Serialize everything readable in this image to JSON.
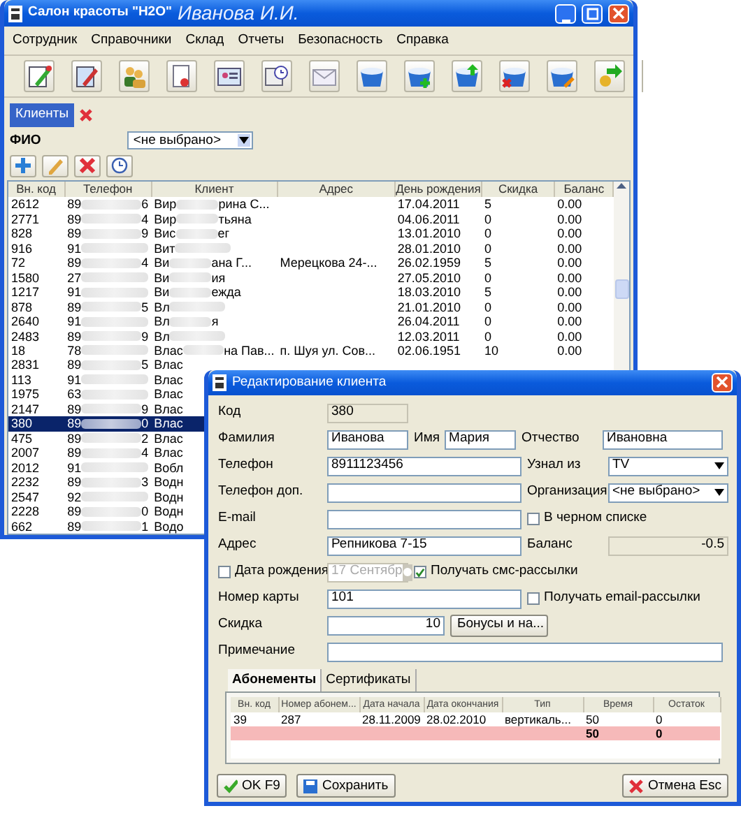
{
  "window": {
    "title": "Салон красоты \"H2O\"",
    "user": "Иванова И.И."
  },
  "menu": [
    "Сотрудник",
    "Справочники",
    "Склад",
    "Отчеты",
    "Безопасность",
    "Справка"
  ],
  "doc_tabs": [
    {
      "label": "Клиенты",
      "selected": true
    }
  ],
  "filter": {
    "label": "ФИО",
    "value": "<не выбрано>"
  },
  "clients": {
    "columns": [
      "Вн. код",
      "Телефон",
      "Клиент",
      "Адрес",
      "День рождения",
      "Скидка",
      "Баланс"
    ],
    "rows": [
      {
        "selected": false,
        "code": "2612",
        "phone": [
          "89",
          "6"
        ],
        "client": [
          "Вир",
          "рина С..."
        ],
        "birthday": "17.04.2011",
        "discount": "5",
        "balance": "0.00"
      },
      {
        "selected": false,
        "code": "2771",
        "phone": [
          "89",
          "4"
        ],
        "client": [
          "Вир",
          "тьяна"
        ],
        "birthday": "04.06.2011",
        "discount": "0",
        "balance": "0.00"
      },
      {
        "selected": false,
        "code": "828",
        "phone": [
          "89",
          "9"
        ],
        "client": [
          "Вис",
          "ег"
        ],
        "birthday": "13.01.2010",
        "discount": "0",
        "balance": "0.00"
      },
      {
        "selected": false,
        "code": "916",
        "phone": [
          "91"
        ],
        "client": [
          "Вит"
        ],
        "birthday": "28.01.2010",
        "discount": "0",
        "balance": "0.00"
      },
      {
        "selected": false,
        "code": "72",
        "phone": [
          "89",
          "4"
        ],
        "client": [
          "Ви",
          "ана Г..."
        ],
        "address": "Мерецкова 24-...",
        "birthday": "26.02.1959",
        "discount": "5",
        "balance": "0.00"
      },
      {
        "selected": false,
        "code": "1580",
        "phone": [
          "27"
        ],
        "client": [
          "Ви",
          "ия"
        ],
        "birthday": "27.05.2010",
        "discount": "0",
        "balance": "0.00"
      },
      {
        "selected": false,
        "code": "1217",
        "phone": [
          "91"
        ],
        "client": [
          "Ви",
          "ежда"
        ],
        "birthday": "18.03.2010",
        "discount": "5",
        "balance": "0.00"
      },
      {
        "selected": false,
        "code": "878",
        "phone": [
          "89",
          "5"
        ],
        "client": [
          "Вл"
        ],
        "birthday": "21.01.2010",
        "discount": "0",
        "balance": "0.00"
      },
      {
        "selected": false,
        "code": "2640",
        "phone": [
          "91"
        ],
        "client": [
          "Вл",
          "я"
        ],
        "birthday": "26.04.2011",
        "discount": "0",
        "balance": "0.00"
      },
      {
        "selected": false,
        "code": "2483",
        "phone": [
          "89",
          "9"
        ],
        "client": [
          "Вл"
        ],
        "birthday": "12.03.2011",
        "discount": "0",
        "balance": "0.00"
      },
      {
        "selected": false,
        "code": "18",
        "phone": [
          "78"
        ],
        "client": [
          "Влас",
          "на Пав..."
        ],
        "address": "п. Шуя ул. Сов...",
        "birthday": "02.06.1951",
        "discount": "10",
        "balance": "0.00"
      },
      {
        "selected": false,
        "code": "2831",
        "phone": [
          "89",
          "5"
        ],
        "client": [
          "Влас"
        ]
      },
      {
        "selected": false,
        "code": "113",
        "phone": [
          "91"
        ],
        "client": [
          "Влас"
        ]
      },
      {
        "selected": false,
        "code": "1975",
        "phone": [
          "63"
        ],
        "client": [
          "Влас"
        ]
      },
      {
        "selected": false,
        "code": "2147",
        "phone": [
          "89",
          "9"
        ],
        "client": [
          "Влас"
        ]
      },
      {
        "selected": true,
        "code": "380",
        "phone": [
          "89",
          "0"
        ],
        "client": [
          "Влас"
        ]
      },
      {
        "selected": false,
        "code": "475",
        "phone": [
          "89",
          "2"
        ],
        "client": [
          "Влас"
        ]
      },
      {
        "selected": false,
        "code": "2007",
        "phone": [
          "89",
          "4"
        ],
        "client": [
          "Влас"
        ]
      },
      {
        "selected": false,
        "code": "2012",
        "phone": [
          "91"
        ],
        "client": [
          "Вобл"
        ]
      },
      {
        "selected": false,
        "code": "2232",
        "phone": [
          "89",
          "3"
        ],
        "client": [
          "Водн"
        ]
      },
      {
        "selected": false,
        "code": "2547",
        "phone": [
          "92"
        ],
        "client": [
          "Водн"
        ]
      },
      {
        "selected": false,
        "code": "2228",
        "phone": [
          "89",
          "0"
        ],
        "client": [
          "Водн"
        ]
      },
      {
        "selected": false,
        "code": "662",
        "phone": [
          "89",
          "1"
        ],
        "client": [
          "Водо"
        ]
      }
    ]
  },
  "dialog": {
    "title": "Редактирование клиента",
    "rows": [
      [
        {
          "kind": "label",
          "text": "Код"
        },
        {
          "kind": "readonly",
          "value": "380"
        }
      ],
      [
        {
          "kind": "label",
          "text": "Фамилия"
        },
        {
          "kind": "input",
          "value": "Иванова"
        },
        {
          "kind": "label",
          "text": "Имя"
        },
        {
          "kind": "input",
          "value": "Мария"
        },
        {
          "kind": "label",
          "text": "Отчество"
        },
        {
          "kind": "input",
          "value": "Ивановна"
        }
      ],
      [
        {
          "kind": "label",
          "text": "Телефон"
        },
        {
          "kind": "input",
          "value": "8911123456"
        },
        {
          "kind": "label",
          "text": "Узнал из"
        },
        {
          "kind": "select",
          "value": "TV"
        }
      ],
      [
        {
          "kind": "label",
          "text": "Телефон доп."
        },
        {
          "kind": "input"
        },
        {
          "kind": "label",
          "text": "Организация"
        },
        {
          "kind": "select",
          "value": "<не выбрано>"
        }
      ],
      [
        {
          "kind": "label",
          "text": "E-mail"
        },
        {
          "kind": "input"
        },
        {
          "kind": "check",
          "text": "В черном списке",
          "checked": false
        }
      ],
      [
        {
          "kind": "label",
          "text": "Адрес"
        },
        {
          "kind": "input",
          "value": "Репникова 7-15"
        },
        {
          "kind": "label",
          "text": "Баланс"
        },
        {
          "kind": "readonly_number",
          "value": "-0.5"
        }
      ],
      [
        {
          "kind": "check",
          "text": "Дата рождения",
          "checked": false
        },
        {
          "kind": "date",
          "value": "17 Сентябр",
          "disabled": true
        },
        {
          "kind": "check",
          "text": "Получать смс-рассылки",
          "checked": true
        }
      ],
      [
        {
          "kind": "label",
          "text": "Номер карты"
        },
        {
          "kind": "input",
          "value": "101"
        },
        {
          "kind": "check",
          "text": "Получать email-рассылки",
          "checked": false
        }
      ],
      [
        {
          "kind": "label",
          "text": "Скидка"
        },
        {
          "kind": "number",
          "value": "10"
        },
        {
          "kind": "button",
          "text": "Бонусы и на..."
        }
      ],
      [
        {
          "kind": "label",
          "text": "Примечание"
        },
        {
          "kind": "input"
        }
      ]
    ],
    "tabs": [
      {
        "label": "Абонементы",
        "selected": true
      },
      {
        "label": "Сертификаты",
        "selected": false
      }
    ],
    "sub_table": {
      "columns": [
        "Вн. код",
        "Номер абонем...",
        "Дата начала",
        "Дата окончания",
        "Тип",
        "Время",
        "Остаток"
      ],
      "rows": [
        {
          "kind": "item",
          "cells": [
            "39",
            "287",
            "28.11.2009",
            "28.02.2010",
            "вертикаль...",
            "50",
            "0"
          ]
        },
        {
          "kind": "total",
          "cells": [
            "",
            "",
            "",
            "",
            "",
            "50",
            "0"
          ]
        }
      ]
    },
    "buttons": [
      {
        "kind": "ok",
        "label": "OK F9"
      },
      {
        "kind": "save",
        "label": "Сохранить"
      },
      {
        "kind": "cancel",
        "label": "Отмена Esc"
      }
    ]
  }
}
